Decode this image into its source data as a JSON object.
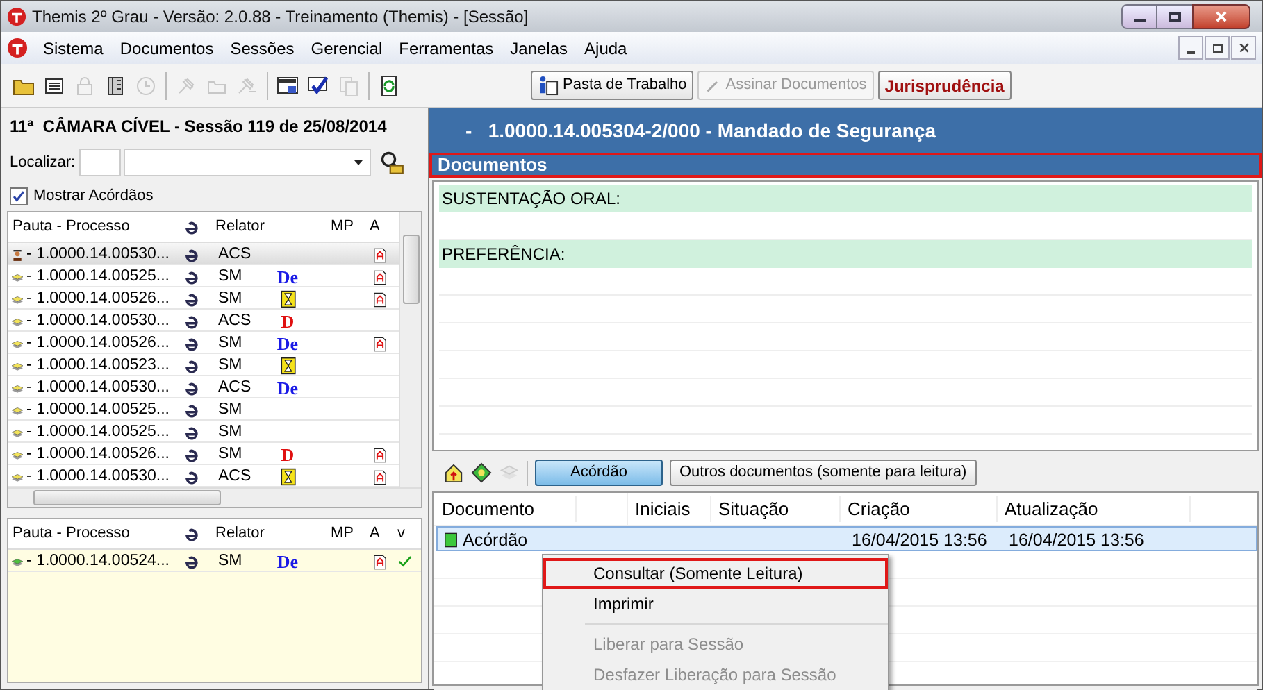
{
  "window": {
    "title": "Themis 2º Grau - Versão: 2.0.88 - Treinamento (Themis) - [Sessão]"
  },
  "menu": [
    "Sistema",
    "Documentos",
    "Sessões",
    "Gerencial",
    "Ferramentas",
    "Janelas",
    "Ajuda"
  ],
  "toolbar": {
    "icons": [
      {
        "disabled": false
      },
      {
        "disabled": false
      },
      {
        "disabled": true
      },
      {
        "disabled": false
      },
      {
        "disabled": true
      },
      {
        "disabled": true
      },
      {
        "disabled": true
      },
      {
        "disabled": true
      },
      {
        "disabled": false
      },
      {
        "disabled": false
      },
      {
        "disabled": true
      },
      {
        "disabled": false
      }
    ],
    "buttons": [
      {
        "label": "Pasta de Trabalho",
        "kind": "normal",
        "disabled": false
      },
      {
        "label": "Assinar Documentos",
        "kind": "normal",
        "disabled": true
      },
      {
        "label": "Jurisprudência",
        "kind": "emphasis",
        "disabled": false
      }
    ]
  },
  "session": {
    "title": "11ª  CÂMARA CÍVEL - Sessão 119 de 25/08/2014",
    "search_label": "Localizar:",
    "show_acordaos": {
      "label": "Mostrar Acórdãos",
      "checked": true
    }
  },
  "pauta_columns": {
    "process": "Pauta - Processo",
    "relator": "Relator",
    "mp": "MP",
    "a": "A"
  },
  "julgados_columns": {
    "process": "Pauta - Processo",
    "relator": "Relator",
    "mp": "MP",
    "a": "A",
    "v": "v"
  },
  "pauta": [
    {
      "kind": "judge",
      "process": "- 1.0000.14.00530...",
      "relator": "ACS",
      "acordao": true,
      "selected": true
    },
    {
      "kind": "stack",
      "process": "- 1.0000.14.00525...",
      "relator": "SM",
      "flag": {
        "kind": "letters",
        "text": "De",
        "color": "#1a1ae6"
      },
      "acordao": true,
      "selected": false
    },
    {
      "kind": "stack",
      "process": "- 1.0000.14.00526...",
      "relator": "SM",
      "flag": {
        "kind": "hourglass"
      },
      "acordao": true,
      "selected": false
    },
    {
      "kind": "stack",
      "process": "- 1.0000.14.00530...",
      "relator": "ACS",
      "flag": {
        "kind": "letters",
        "text": "D",
        "color": "#e01010"
      },
      "acordao": false,
      "selected": false
    },
    {
      "kind": "stack",
      "process": "- 1.0000.14.00526...",
      "relator": "SM",
      "flag": {
        "kind": "letters",
        "text": "De",
        "color": "#1a1ae6"
      },
      "acordao": true,
      "selected": false
    },
    {
      "kind": "stack",
      "process": "- 1.0000.14.00523...",
      "relator": "SM",
      "flag": {
        "kind": "hourglass"
      },
      "acordao": false,
      "selected": false
    },
    {
      "kind": "stack",
      "process": "- 1.0000.14.00530...",
      "relator": "ACS",
      "flag": {
        "kind": "letters",
        "text": "De",
        "color": "#1a1ae6"
      },
      "acordao": false,
      "selected": false
    },
    {
      "kind": "stack",
      "process": "- 1.0000.14.00525...",
      "relator": "SM",
      "acordao": false,
      "selected": false
    },
    {
      "kind": "stack",
      "process": "- 1.0000.14.00525...",
      "relator": "SM",
      "acordao": false,
      "selected": false
    },
    {
      "kind": "stack",
      "process": "- 1.0000.14.00526...",
      "relator": "SM",
      "flag": {
        "kind": "letters",
        "text": "D",
        "color": "#e01010"
      },
      "acordao": true,
      "selected": false
    },
    {
      "kind": "stack",
      "process": "- 1.0000.14.00530...",
      "relator": "ACS",
      "flag": {
        "kind": "hourglass"
      },
      "acordao": true,
      "selected": false
    }
  ],
  "julgados": [
    {
      "kind": "stack-green",
      "process": "- 1.0000.14.00524...",
      "relator": "SM",
      "flag": {
        "kind": "letters",
        "text": "De",
        "color": "#1a1ae6"
      },
      "acordao": true,
      "v": true
    }
  ],
  "process_title": "-   1.0000.14.005304-2/000 - Mandado de Segurança",
  "documents_section": {
    "title": "Documentos",
    "highlighted": true
  },
  "notes": [
    {
      "label": "SUSTENTAÇÃO ORAL:"
    },
    {
      "label": "PREFERÊNCIA:"
    }
  ],
  "docs_toolbar": {
    "icons": [
      {
        "disabled": false
      },
      {
        "disabled": false
      },
      {
        "disabled": true
      }
    ],
    "tabs": [
      {
        "label": "Acórdão",
        "selected": true
      },
      {
        "label": "Outros documentos (somente para leitura)",
        "selected": false
      }
    ]
  },
  "docs_table": {
    "columns": [
      "Documento",
      "Iniciais",
      "Situação",
      "Criação",
      "Atualização"
    ],
    "rows": [
      {
        "documento": "Acórdão",
        "criacao": "16/04/2015 13:56",
        "atualizacao": "16/04/2015 13:56",
        "selected": true
      }
    ]
  },
  "context_menu": [
    {
      "kind": "item",
      "label": "Consultar (Somente Leitura)",
      "disabled": false,
      "highlighted": true
    },
    {
      "kind": "item",
      "label": "Imprimir",
      "disabled": false,
      "highlighted": false
    },
    {
      "kind": "separator"
    },
    {
      "kind": "item",
      "label": "Liberar para Sessão",
      "disabled": true,
      "highlighted": false
    },
    {
      "kind": "item",
      "label": "Desfazer Liberação para Sessão",
      "disabled": true,
      "highlighted": false
    }
  ]
}
